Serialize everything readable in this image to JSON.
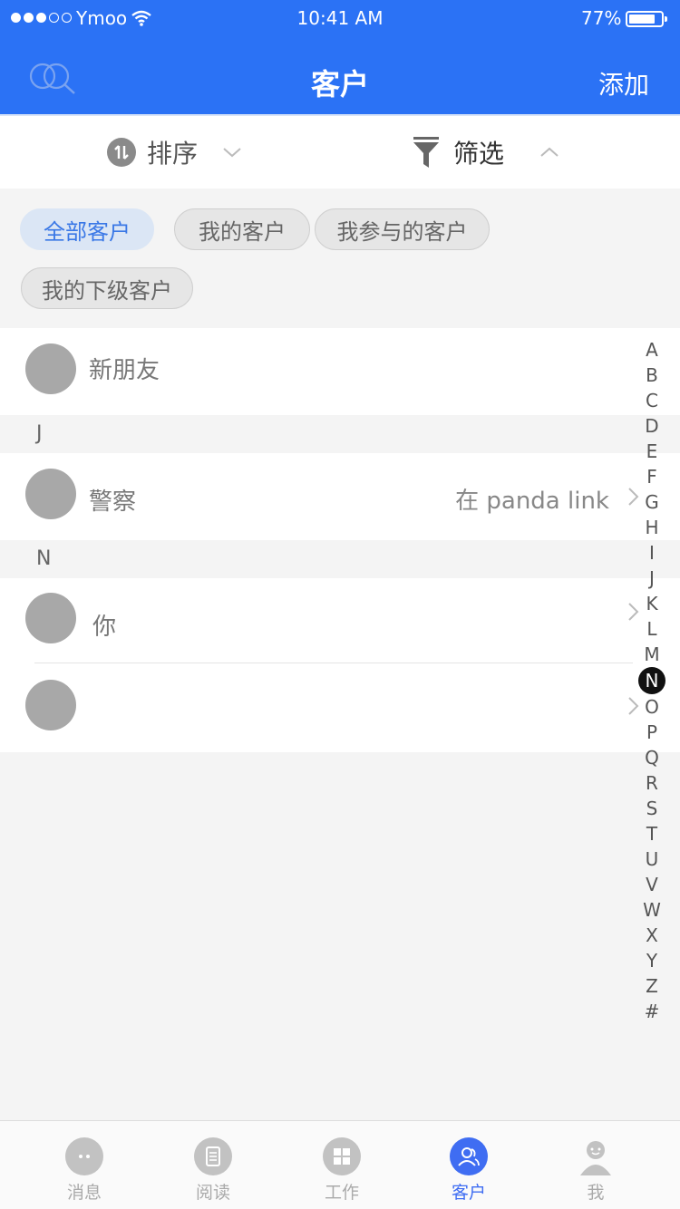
{
  "status_bar": {
    "carrier": "Ymoo",
    "time": "10:41 AM",
    "battery": "77%"
  },
  "nav": {
    "title": "客户",
    "add_label": "添加",
    "search_icon": "search-icon"
  },
  "toolbar": {
    "sort_label": "排序",
    "filter_label": "筛选"
  },
  "chips": [
    {
      "label": "全部客户",
      "active": true
    },
    {
      "label": "我的客户",
      "active": false
    },
    {
      "label": "我参与的客户",
      "active": false
    },
    {
      "label": "我的下级客户",
      "active": false
    }
  ],
  "customers": {
    "top": {
      "name": "新朋友"
    },
    "section_j": "J",
    "j_item": {
      "name": "警察",
      "location": "在 panda link"
    },
    "section_n": "N",
    "n_items": [
      {
        "name": "你"
      },
      {
        "name": ""
      }
    ]
  },
  "alpha_index": {
    "letters": [
      "A",
      "B",
      "C",
      "D",
      "E",
      "F",
      "G",
      "H",
      "I",
      "J",
      "K",
      "L",
      "M",
      "N",
      "O",
      "P",
      "Q",
      "R",
      "S",
      "T",
      "U",
      "V",
      "W",
      "X",
      "Y",
      "Z",
      "#"
    ],
    "selected": "N"
  },
  "tabbar": {
    "tabs": [
      {
        "label": "消息",
        "icon": "message-icon"
      },
      {
        "label": "阅读",
        "icon": "document-icon"
      },
      {
        "label": "工作",
        "icon": "grid-icon"
      },
      {
        "label": "客户",
        "icon": "users-icon",
        "active": true
      },
      {
        "label": "我",
        "icon": "person-icon"
      }
    ]
  },
  "colors": {
    "brand": "#2b72f5",
    "tab_active": "#3f6df2",
    "chip_active_bg": "#dbe6f5",
    "chip_active_text": "#3a78e6"
  }
}
